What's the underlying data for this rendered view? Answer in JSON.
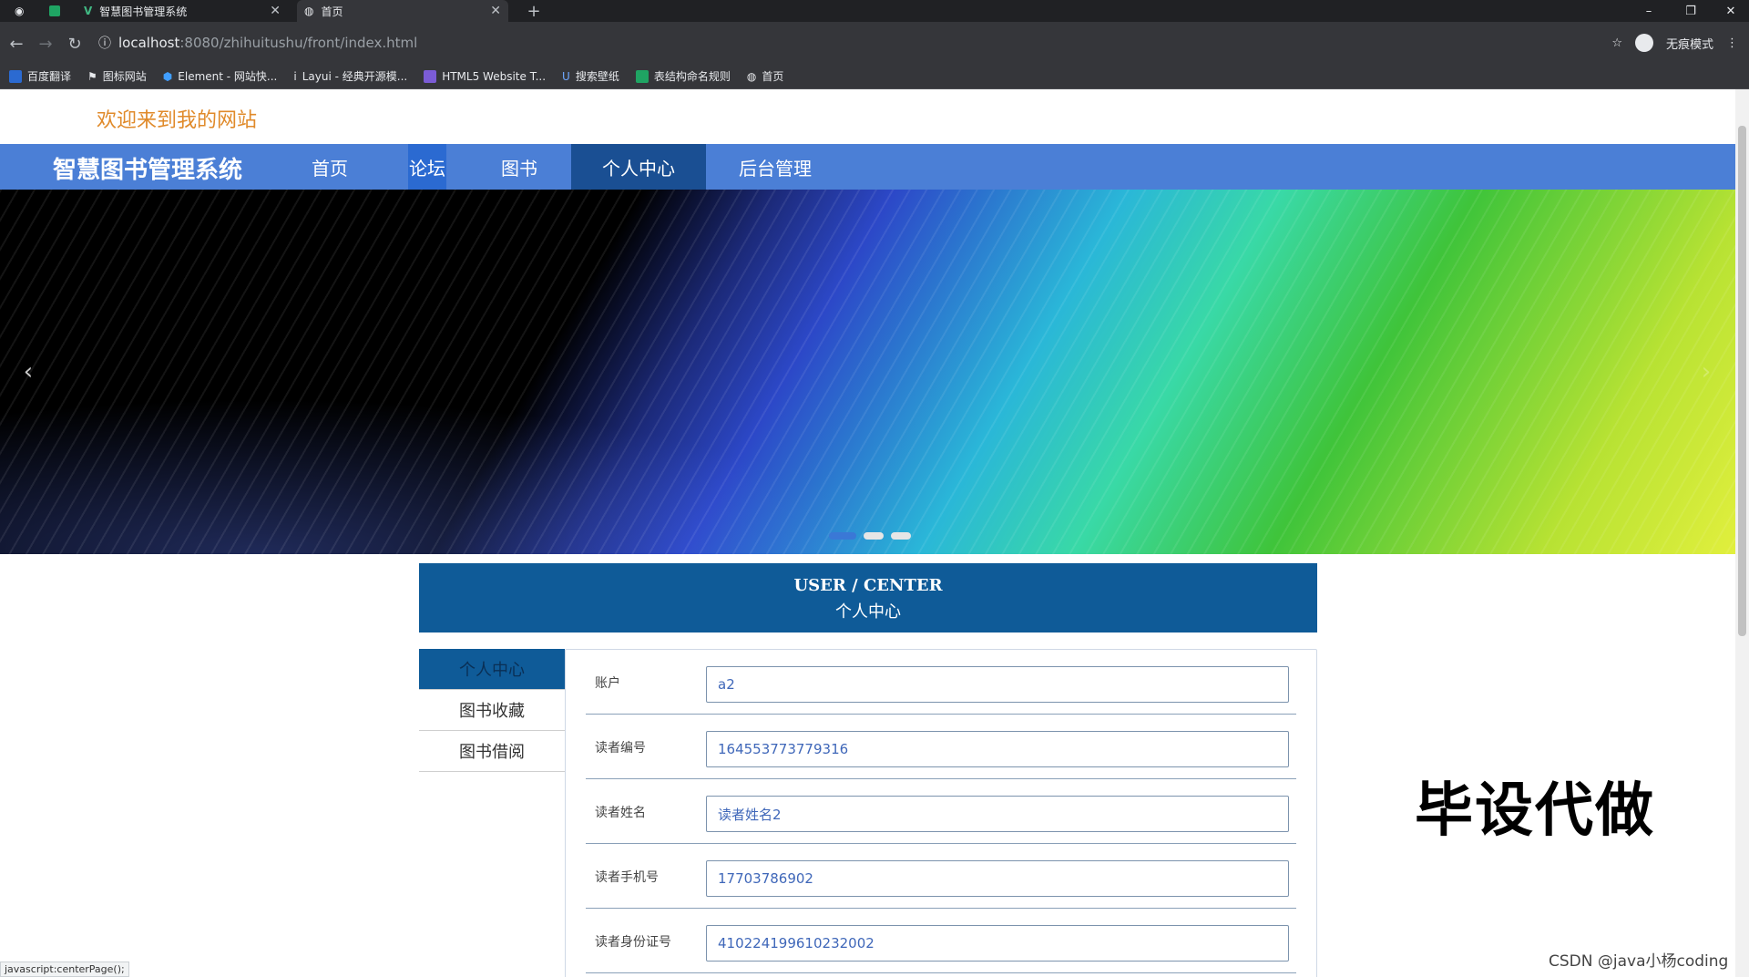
{
  "browser": {
    "tabs": [
      {
        "title": "智慧图书管理系统"
      },
      {
        "title": "首页"
      }
    ],
    "url_host": "localhost",
    "url_path": ":8080/zhihuitushu/front/index.html",
    "profile_label": "无痕模式",
    "bookmarks": [
      {
        "label": "百度翻译"
      },
      {
        "label": "图标网站"
      },
      {
        "label": "Element - 网站快..."
      },
      {
        "label": "Layui - 经典开源模..."
      },
      {
        "label": "HTML5 Website T..."
      },
      {
        "label": "搜索壁纸"
      },
      {
        "label": "表结构命名规则"
      },
      {
        "label": "首页"
      }
    ]
  },
  "site": {
    "welcome": "欢迎来到我的网站",
    "brand": "智慧图书管理系统",
    "nav": [
      {
        "label": "首页"
      },
      {
        "label": "论坛"
      },
      {
        "label": "图书"
      },
      {
        "label": "个人中心"
      },
      {
        "label": "后台管理"
      }
    ]
  },
  "user_center": {
    "title_en": "USER / CENTER",
    "title_cn": "个人中心",
    "menu": [
      {
        "label": "个人中心"
      },
      {
        "label": "图书收藏"
      },
      {
        "label": "图书借阅"
      }
    ],
    "fields": [
      {
        "label": "账户",
        "value": "a2"
      },
      {
        "label": "读者编号",
        "value": "164553773779316"
      },
      {
        "label": "读者姓名",
        "value": "读者姓名2"
      },
      {
        "label": "读者手机号",
        "value": "17703786902"
      },
      {
        "label": "读者身份证号",
        "value": "410224199610232002"
      }
    ]
  },
  "overlay": {
    "watermark": "毕设代做",
    "credit": "CSDN @java小杨coding",
    "status": "javascript:centerPage();"
  }
}
